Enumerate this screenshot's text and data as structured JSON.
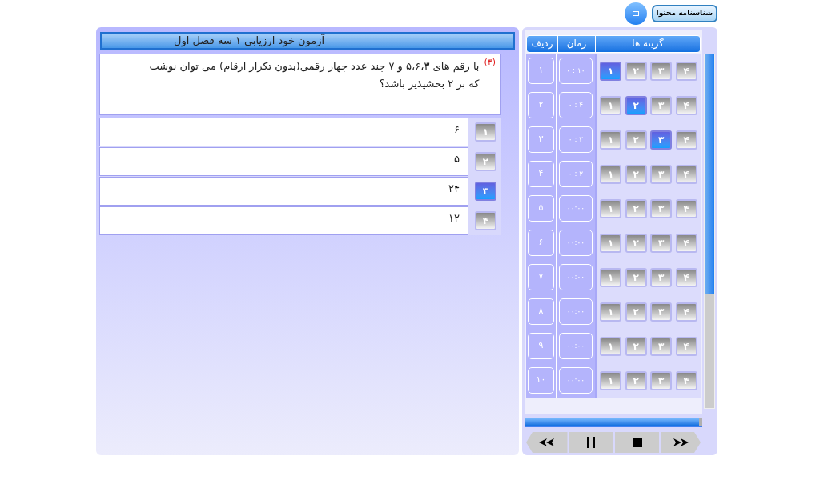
{
  "top_bar": {
    "info_button": "شناسنامه محتوا"
  },
  "quiz": {
    "title": "آزمون خود ارزیابی ۱ سه فصل اول",
    "question_number": "(۳)",
    "question": "با رقم های ۵،۶،۳ و ۷ چند عدد چهار رقمی(بدون تکرار ارقام) می توان نوشت که بر ۲ بخشپذیر باشد؟",
    "options": [
      {
        "number": "۱",
        "text": "۶",
        "selected": false
      },
      {
        "number": "۲",
        "text": "۵",
        "selected": false
      },
      {
        "number": "۳",
        "text": "۲۴",
        "selected": true
      },
      {
        "number": "۴",
        "text": "۱۲",
        "selected": false
      }
    ]
  },
  "answer_sheet": {
    "columns": [
      "گزینه ها",
      "زمان",
      "ردیف"
    ],
    "rows": [
      {
        "choices": [
          {
            "label": "۴",
            "selected": false
          },
          {
            "label": "۳",
            "selected": false
          },
          {
            "label": "۲",
            "selected": false
          },
          {
            "label": "۱",
            "selected": true
          }
        ],
        "time": "۰ : ۱۰",
        "number": "۱"
      },
      {
        "choices": [
          {
            "label": "۴",
            "selected": false
          },
          {
            "label": "۳",
            "selected": false
          },
          {
            "label": "۲",
            "selected": true
          },
          {
            "label": "۱",
            "selected": false
          }
        ],
        "time": "۰ : ۴",
        "number": "۲"
      },
      {
        "choices": [
          {
            "label": "۴",
            "selected": false
          },
          {
            "label": "۳",
            "selected": true
          },
          {
            "label": "۲",
            "selected": false
          },
          {
            "label": "۱",
            "selected": false
          }
        ],
        "time": "۰ : ۳",
        "number": "۳"
      },
      {
        "choices": [
          {
            "label": "۴",
            "selected": false
          },
          {
            "label": "۳",
            "selected": false
          },
          {
            "label": "۲",
            "selected": false
          },
          {
            "label": "۱",
            "selected": false
          }
        ],
        "time": "۰ : ۲",
        "number": "۴"
      },
      {
        "choices": [
          {
            "label": "۴",
            "selected": false
          },
          {
            "label": "۳",
            "selected": false
          },
          {
            "label": "۲",
            "selected": false
          },
          {
            "label": "۱",
            "selected": false
          }
        ],
        "time": "۰۰:۰۰",
        "number": "۵"
      },
      {
        "choices": [
          {
            "label": "۴",
            "selected": false
          },
          {
            "label": "۳",
            "selected": false
          },
          {
            "label": "۲",
            "selected": false
          },
          {
            "label": "۱",
            "selected": false
          }
        ],
        "time": "۰۰:۰۰",
        "number": "۶"
      },
      {
        "choices": [
          {
            "label": "۴",
            "selected": false
          },
          {
            "label": "۳",
            "selected": false
          },
          {
            "label": "۲",
            "selected": false
          },
          {
            "label": "۱",
            "selected": false
          }
        ],
        "time": "۰۰:۰۰",
        "number": "۷"
      },
      {
        "choices": [
          {
            "label": "۴",
            "selected": false
          },
          {
            "label": "۳",
            "selected": false
          },
          {
            "label": "۲",
            "selected": false
          },
          {
            "label": "۱",
            "selected": false
          }
        ],
        "time": "۰۰:۰۰",
        "number": "۸"
      },
      {
        "choices": [
          {
            "label": "۴",
            "selected": false
          },
          {
            "label": "۳",
            "selected": false
          },
          {
            "label": "۲",
            "selected": false
          },
          {
            "label": "۱",
            "selected": false
          }
        ],
        "time": "۰۰:۰۰",
        "number": "۹"
      },
      {
        "choices": [
          {
            "label": "۴",
            "selected": false
          },
          {
            "label": "۳",
            "selected": false
          },
          {
            "label": "۲",
            "selected": false
          },
          {
            "label": "۱",
            "selected": false
          }
        ],
        "time": "۰۰:۰۰",
        "number": "۱۰"
      }
    ]
  },
  "progress": {
    "level": 0.98
  }
}
